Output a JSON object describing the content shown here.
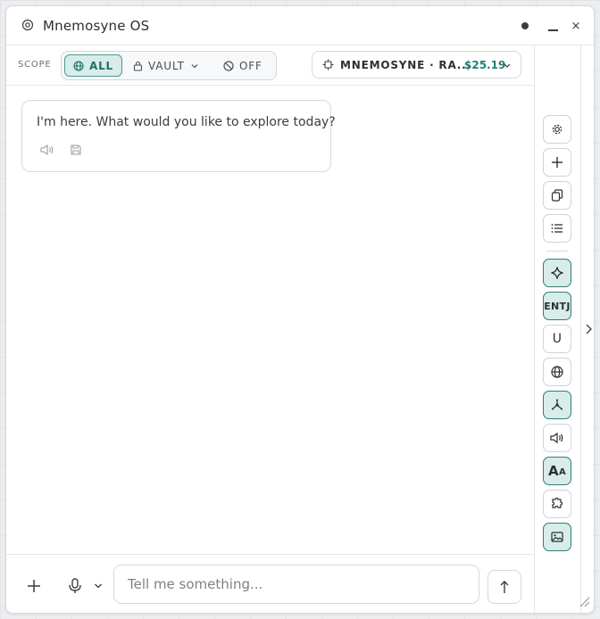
{
  "window": {
    "title": "Mnemosyne OS",
    "close_glyph": "×"
  },
  "scope": {
    "label": "SCOPE",
    "options": [
      {
        "label": "ALL",
        "icon": "globe-icon",
        "selected": true
      },
      {
        "label": "VAULT",
        "icon": "lock-icon",
        "selected": false
      },
      {
        "label": "OFF",
        "icon": "ban-icon",
        "selected": false
      }
    ]
  },
  "model": {
    "name": "MNEMOSYNE · RA...",
    "price": "$25.19",
    "icon": "chip-icon"
  },
  "messages": [
    {
      "role": "assistant",
      "text": "I'm here. What would you like to explore today?"
    }
  ],
  "composer": {
    "placeholder": "Tell me something...",
    "value": ""
  },
  "rail": {
    "mbti": "ENTJ",
    "user": "U",
    "font_size_big": "A",
    "font_size_small": "A",
    "items": [
      {
        "icon": "settings-icon",
        "active": false
      },
      {
        "icon": "plus-icon",
        "active": false
      },
      {
        "icon": "copy-icon",
        "active": false
      },
      {
        "icon": "list-icon",
        "active": false
      },
      {
        "icon": "sparkle-icon",
        "active": true
      },
      {
        "icon": "mbti-badge",
        "active": true
      },
      {
        "icon": "user-badge",
        "active": false
      },
      {
        "icon": "globe-icon",
        "active": false
      },
      {
        "icon": "graph-icon",
        "active": true
      },
      {
        "icon": "speaker-icon",
        "active": false
      },
      {
        "icon": "text-size-icon",
        "active": true
      },
      {
        "icon": "puzzle-icon",
        "active": false
      },
      {
        "icon": "image-icon",
        "active": true
      }
    ]
  },
  "colors": {
    "accent": "#2f7e76",
    "accent_bg": "#d8ecea",
    "price": "#1f7f75"
  }
}
